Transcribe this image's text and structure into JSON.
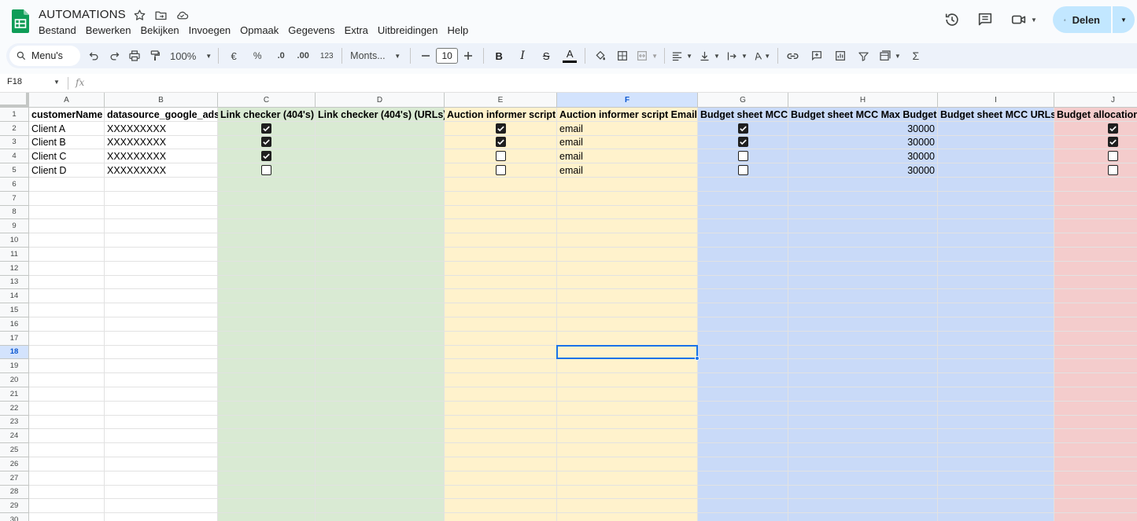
{
  "document": {
    "title": "AUTOMATIONS"
  },
  "menu": [
    "Bestand",
    "Bewerken",
    "Bekijken",
    "Invoegen",
    "Opmaak",
    "Gegevens",
    "Extra",
    "Uitbreidingen",
    "Help"
  ],
  "share": {
    "label": "Delen"
  },
  "toolbar": {
    "search_label": "Menu's",
    "zoom": "100%",
    "currency": "€",
    "percent": "%",
    "dec_decrease": ".0",
    "dec_increase": ".00",
    "number_format": "123",
    "font": "Monts...",
    "font_size": "10"
  },
  "formula_bar": {
    "cell_ref": "F18",
    "fx_label": "fx",
    "value": ""
  },
  "grid": {
    "selected_column": "F",
    "selected_row": "18",
    "columns": [
      {
        "letter": "A",
        "bg": "#ffffff"
      },
      {
        "letter": "B",
        "bg": "#ffffff"
      },
      {
        "letter": "C",
        "bg": "#d9ead3"
      },
      {
        "letter": "D",
        "bg": "#d9ead3"
      },
      {
        "letter": "E",
        "bg": "#fff2cc"
      },
      {
        "letter": "F",
        "bg": "#fff2cc"
      },
      {
        "letter": "G",
        "bg": "#c9daf8"
      },
      {
        "letter": "H",
        "bg": "#c9daf8"
      },
      {
        "letter": "I",
        "bg": "#c9daf8"
      },
      {
        "letter": "J",
        "bg": "#f4cccc"
      }
    ],
    "row_numbers": [
      "1",
      "2",
      "3",
      "4",
      "5",
      "6",
      "7",
      "8",
      "9",
      "10",
      "11",
      "12",
      "13",
      "14",
      "15",
      "16",
      "17",
      "18",
      "19",
      "20",
      "21",
      "22",
      "23",
      "24",
      "25",
      "26",
      "27",
      "28",
      "29",
      "30"
    ],
    "headers": [
      "customerName",
      "datasource_google_ads",
      "Link checker (404's)",
      "Link checker (404's) (URLs)",
      "Auction informer script",
      "Auction informer script Email",
      "Budget sheet MCC",
      "Budget sheet MCC Max Budget",
      "Budget sheet MCC URLs",
      "Budget allocation"
    ],
    "rows": [
      {
        "name": "Client A",
        "ads": "XXXXXXXXX",
        "link": true,
        "auction": true,
        "email": "email",
        "mcc": true,
        "max": "30000",
        "alloc": true
      },
      {
        "name": "Client B",
        "ads": "XXXXXXXXX",
        "link": true,
        "auction": true,
        "email": "email",
        "mcc": true,
        "max": "30000",
        "alloc": true
      },
      {
        "name": "Client C",
        "ads": "XXXXXXXXX",
        "link": true,
        "auction": false,
        "email": "email",
        "mcc": false,
        "max": "30000",
        "alloc": false
      },
      {
        "name": "Client D",
        "ads": "XXXXXXXXX",
        "link": false,
        "auction": false,
        "email": "email",
        "mcc": false,
        "max": "30000",
        "alloc": false
      }
    ]
  },
  "colors": {
    "accent": "#1a73e8",
    "share_bg": "#c2e7ff",
    "sheets_green": "#0f9d58"
  }
}
